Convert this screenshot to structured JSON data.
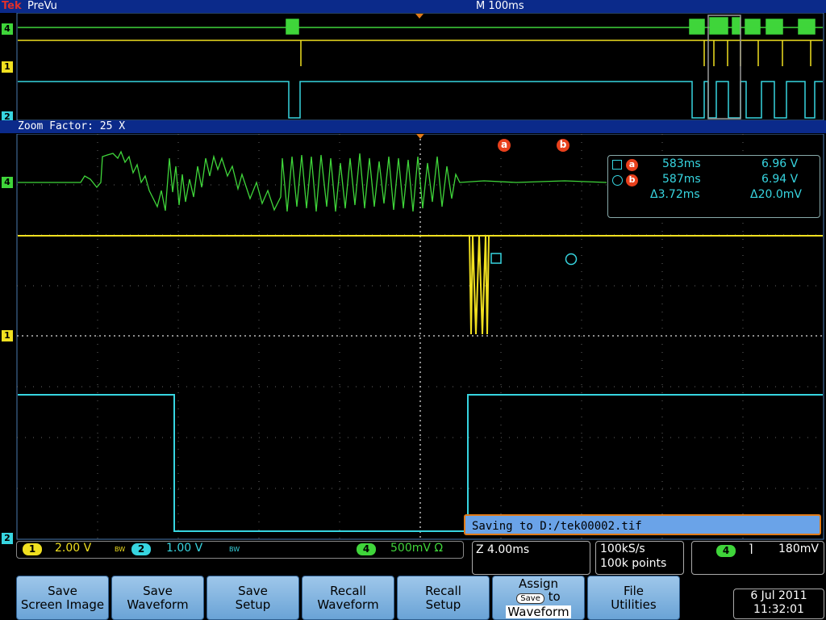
{
  "header": {
    "brand": "Tek",
    "mode": "PreVu",
    "timebase": "M 100ms"
  },
  "zoom": {
    "label": "Zoom Factor: 25 X"
  },
  "channel_markers": {
    "ch4": "4",
    "ch1": "1",
    "ch2": "2"
  },
  "cursor_markers": {
    "a": "a",
    "b": "b"
  },
  "cursor_readout": {
    "a_time": "583ms",
    "a_value": "6.96 V",
    "b_time": "587ms",
    "b_value": "6.94 V",
    "delta_time": "Δ3.72ms",
    "delta_value": "Δ20.0mV"
  },
  "saving": {
    "text": "Saving to D:/tek00002.tif"
  },
  "status": {
    "ch1_num": "1",
    "ch1_scale": "2.00 V",
    "ch1_bw": "BW",
    "ch2_num": "2",
    "ch2_scale": "1.00 V",
    "ch2_bw": "BW",
    "ch4_num": "4",
    "ch4_scale": "500mV Ω",
    "zoom_time": "Z 4.00ms",
    "sample_rate": "100kS/s",
    "record_len": "100k points",
    "trig_ch": "4",
    "trig_slope": "⌉",
    "trig_level": "180mV"
  },
  "buttons": {
    "save_screen_1": "Save",
    "save_screen_2": "Screen Image",
    "save_wfm_1": "Save",
    "save_wfm_2": "Waveform",
    "save_setup_1": "Save",
    "save_setup_2": "Setup",
    "recall_wfm_1": "Recall",
    "recall_wfm_2": "Waveform",
    "recall_setup_1": "Recall",
    "recall_setup_2": "Setup",
    "assign_1": "Assign",
    "assign_key": "Save",
    "assign_to": "to",
    "assign_3": "Waveform",
    "file_util_1": "File",
    "file_util_2": "Utilities"
  },
  "datetime": {
    "date": "6 Jul  2011",
    "time": "11:32:01"
  },
  "colors": {
    "ch1": "#f0e020",
    "ch2": "#37d5e0",
    "ch4": "#3fd53a",
    "accent": "#e07a18"
  }
}
